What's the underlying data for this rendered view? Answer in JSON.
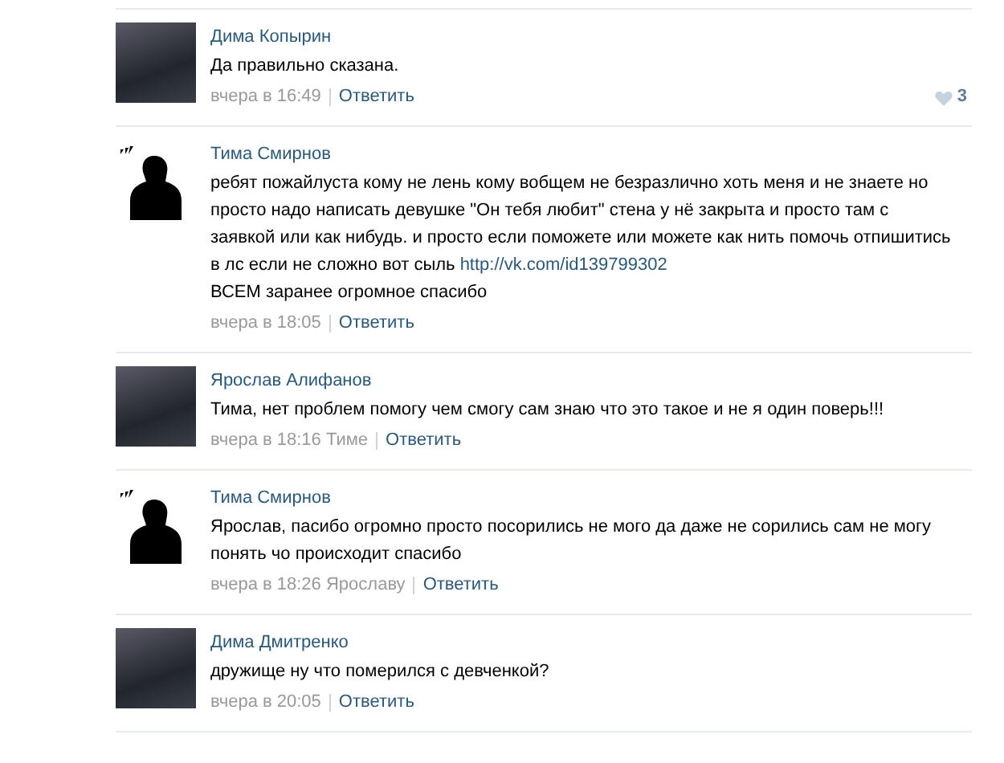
{
  "comments": [
    {
      "author": "Дима Копырин",
      "kind": "photo",
      "text": "Да правильно сказана.",
      "time": "вчера в 16:49",
      "reply": "Ответить",
      "likes": "3"
    },
    {
      "author": "Тима Смирнов",
      "kind": "silhouette",
      "text": "ребят пожайлуста кому не лень кому вобщем не безразлично хоть меня и не знаете но просто надо написать девушке \"Он тебя любит\" стена у нё закрыта и просто там с заявкой или как нибудь. и просто если поможете или можете как нить помочь отпишитись в лс если не сложно вот сыль",
      "link": "http://vk.com/id139799302",
      "text_after": "ВСЕМ заранее огромное спасибо",
      "time": "вчера в 18:05",
      "reply": "Ответить"
    },
    {
      "author": "Ярослав Алифанов",
      "kind": "photo",
      "text": "Тима, нет проблем помогу чем смогу сам знаю что это такое и не я один поверь!!!",
      "time": "вчера в 18:16",
      "reply_to": "Тиме",
      "reply": "Ответить"
    },
    {
      "author": "Тима Смирнов",
      "kind": "silhouette",
      "text": "Ярослав, пасибо огромно просто посорились не мого да даже не сорились сам не могу понять чо происходит спасибо",
      "time": "вчера в 18:26",
      "reply_to": "Ярославу",
      "reply": "Ответить"
    },
    {
      "author": "Дима Дмитренко",
      "kind": "photo",
      "text": "дружище ну что померился с девченкой?",
      "time": "вчера в 20:05",
      "reply": "Ответить"
    }
  ]
}
